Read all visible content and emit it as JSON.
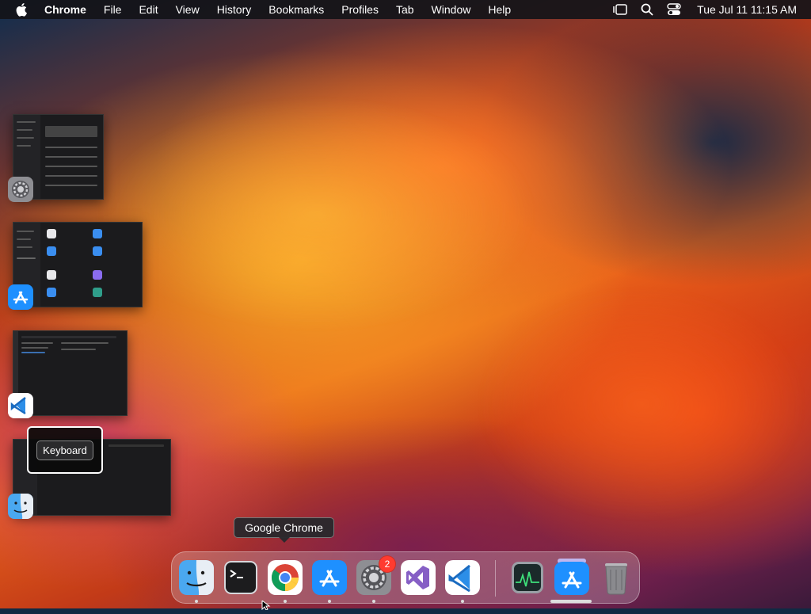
{
  "menubar": {
    "app_name": "Chrome",
    "items": [
      "File",
      "Edit",
      "View",
      "History",
      "Bookmarks",
      "Profiles",
      "Tab",
      "Window",
      "Help"
    ],
    "clock": "Tue Jul 11  11:15 AM"
  },
  "expose": {
    "keyboard_tooltip": "Keyboard",
    "windows": [
      {
        "app": "System Settings",
        "icon": "system-settings-icon"
      },
      {
        "app": "App Store",
        "icon": "app-store-icon"
      },
      {
        "app": "Visual Studio Code",
        "icon": "vscode-icon"
      },
      {
        "app": "Finder",
        "icon": "finder-icon"
      }
    ]
  },
  "dock": {
    "tooltip": "Google Chrome",
    "items": [
      {
        "name": "Finder",
        "icon": "finder-icon"
      },
      {
        "name": "Terminal",
        "icon": "terminal-icon"
      },
      {
        "name": "Google Chrome",
        "icon": "chrome-icon"
      },
      {
        "name": "App Store",
        "icon": "app-store-icon"
      },
      {
        "name": "System Settings",
        "icon": "system-settings-icon",
        "badge": "2"
      },
      {
        "name": "Visual Studio",
        "icon": "visual-studio-icon"
      },
      {
        "name": "Visual Studio Code",
        "icon": "vscode-icon"
      },
      {
        "name": "Activity Monitor",
        "icon": "activity-monitor-icon"
      },
      {
        "name": "App Store (Stack)",
        "icon": "app-store-icon"
      },
      {
        "name": "Trash",
        "icon": "trash-icon"
      }
    ]
  },
  "colors": {
    "menubar_bg": "#141418",
    "badge_red": "#ff3b30",
    "appstore_blue": "#1e90ff",
    "vscode_blue": "#2c8ee8"
  }
}
